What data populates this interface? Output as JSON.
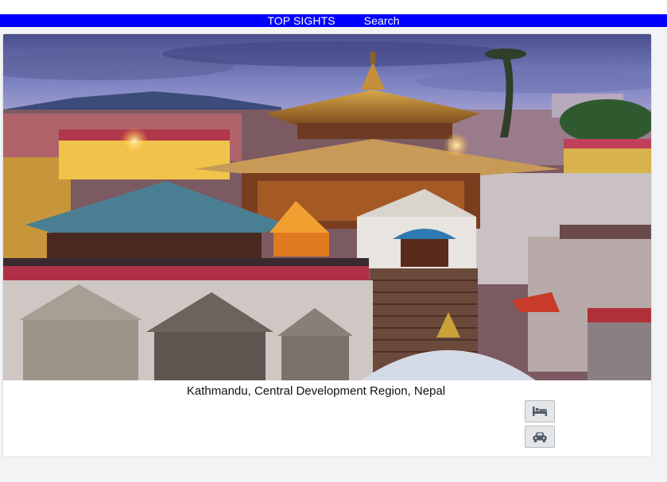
{
  "nav": {
    "items": [
      {
        "label": "TOP SIGHTS"
      },
      {
        "label": "Search"
      }
    ]
  },
  "card": {
    "image_subject": "Pashupatinath temple complex at dusk",
    "caption": "Kathmandu, Central Development Region, Nepal",
    "actions": [
      {
        "icon": "bed-icon"
      },
      {
        "icon": "car-icon"
      }
    ]
  },
  "colors": {
    "navbar": "#0000ff",
    "page_bg": "#f1f3f5",
    "card_bg": "#ffffff",
    "button_bg": "#e4e6e8"
  }
}
